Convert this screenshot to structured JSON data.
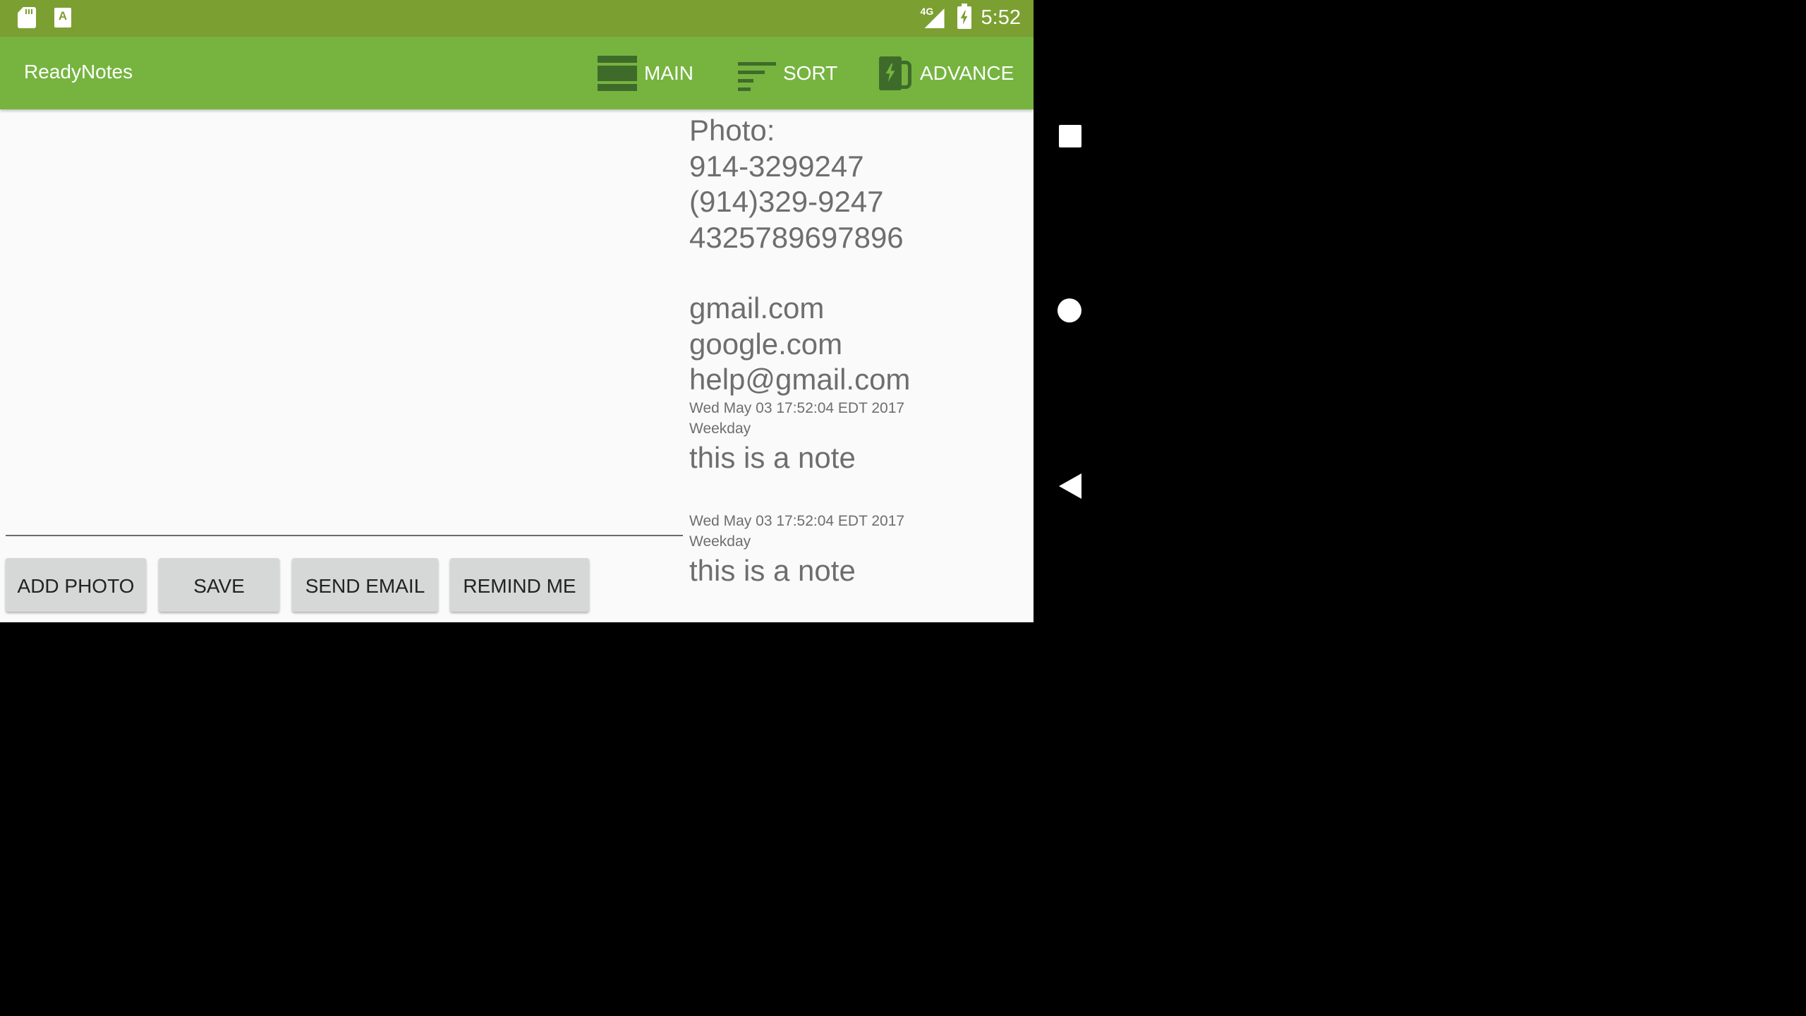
{
  "status_bar": {
    "network_label": "4G",
    "time": "5:52",
    "left_icons": [
      "sd-card-icon",
      "font-a-icon"
    ],
    "right_icons": [
      "signal-icon",
      "battery-charging-icon"
    ]
  },
  "app_bar": {
    "title": "ReadyNotes",
    "actions": [
      {
        "label": "MAIN",
        "icon": "main-icon"
      },
      {
        "label": "SORT",
        "icon": "sort-icon"
      },
      {
        "label": "ADVANCE",
        "icon": "advance-icon"
      }
    ],
    "color": "#76b43f"
  },
  "note_input": {
    "value": ""
  },
  "buttons": {
    "add_photo": "ADD PHOTO",
    "save": "SAVE",
    "send_email": "SEND EMAIL",
    "remind_me": "REMIND ME"
  },
  "notes_panel": {
    "photo_label": "Photo:",
    "phone_1": "914-3299247",
    "phone_2": "(914)329-9247",
    "number_3": "4325789697896",
    "link_1": "gmail.com",
    "link_2": "google.com",
    "email": "help@gmail.com",
    "entries": [
      {
        "date": "Wed May 03 17:52:04 EDT 2017",
        "day_type": "Weekday",
        "text": "this is a note"
      },
      {
        "date": "Wed May 03 17:52:04 EDT 2017",
        "day_type": "Weekday",
        "text": "this is a note"
      }
    ]
  },
  "nav_bar": {
    "icons": [
      "recents-square-icon",
      "home-circle-icon",
      "back-triangle-icon"
    ]
  }
}
